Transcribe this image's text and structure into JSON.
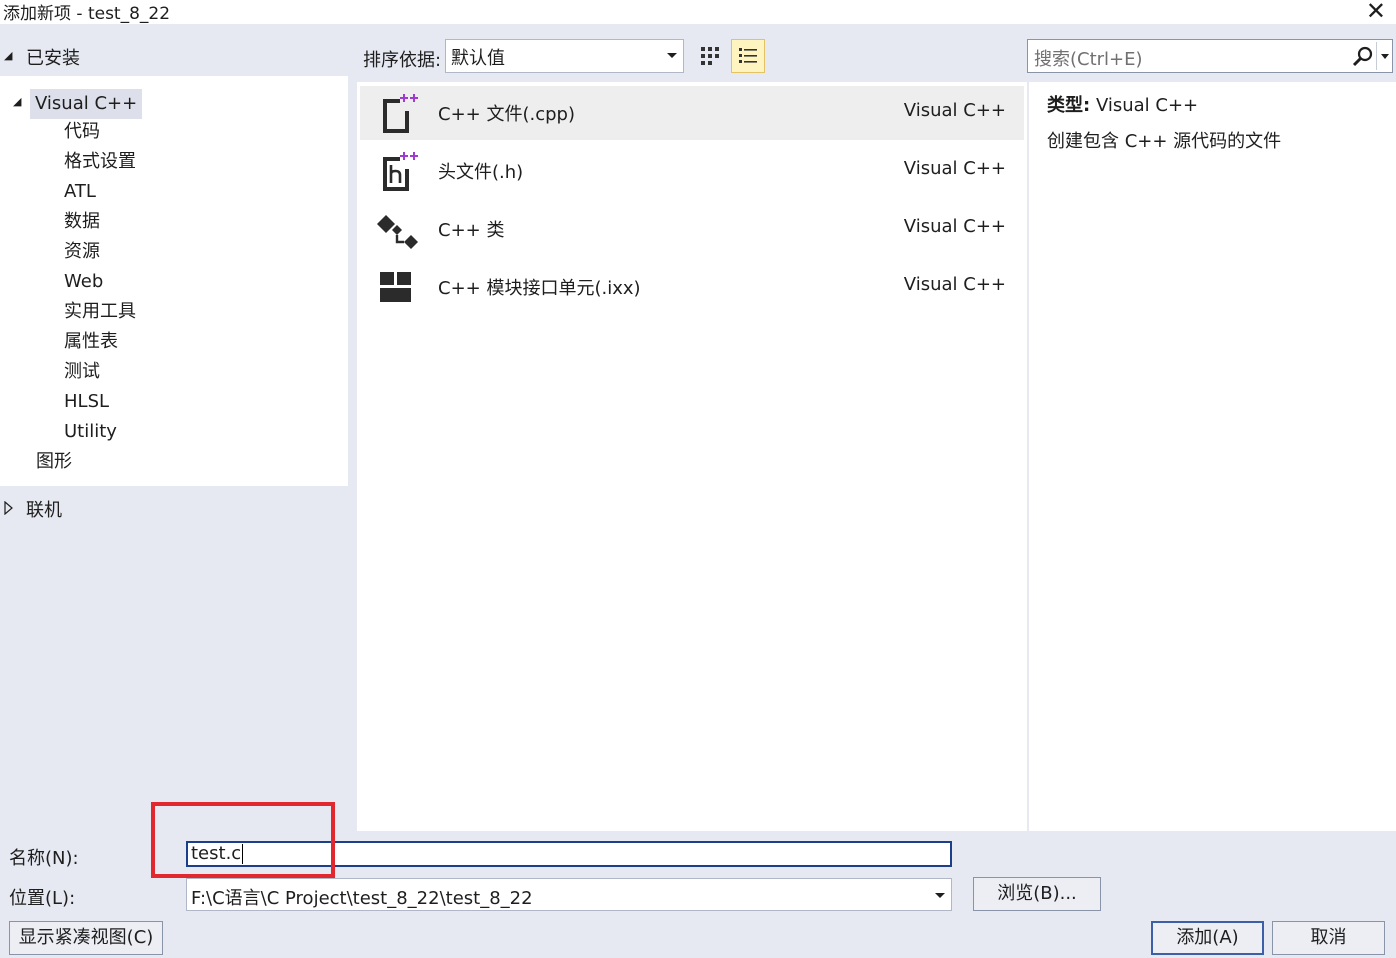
{
  "window": {
    "title": "添加新项 - test_8_22",
    "close_glyph": "✕"
  },
  "left_panel": {
    "installed_label": "已安装",
    "root_item": "Visual C++",
    "children": [
      "代码",
      "格式设置",
      "ATL",
      "数据",
      "资源",
      "Web",
      "实用工具",
      "属性表",
      "测试",
      "HLSL",
      "Utility"
    ],
    "sibling_item": "图形",
    "online_label": "联机"
  },
  "toolbar": {
    "sort_label": "排序依据:",
    "sort_value": "默认值",
    "search_placeholder": "搜索(Ctrl+E)"
  },
  "items": [
    {
      "name": "C++ 文件(.cpp)",
      "type": "Visual C++",
      "icon": "cpp-file-icon",
      "selected": true
    },
    {
      "name": "头文件(.h)",
      "type": "Visual C++",
      "icon": "header-file-icon",
      "selected": false
    },
    {
      "name": "C++ 类",
      "type": "Visual C++",
      "icon": "cpp-class-icon",
      "selected": false
    },
    {
      "name": "C++ 模块接口单元(.ixx)",
      "type": "Visual C++",
      "icon": "module-interface-icon",
      "selected": false
    }
  ],
  "details": {
    "type_label": "类型:",
    "type_value": "Visual C++",
    "description": "创建包含 C++ 源代码的文件"
  },
  "form": {
    "name_label": "名称(N):",
    "name_value": "test.c",
    "location_label": "位置(L):",
    "location_value": "F:\\C语言\\C Project\\test_8_22\\test_8_22",
    "browse_button": "浏览(B)...",
    "compact_view_button": "显示紧凑视图(C)",
    "add_button": "添加(A)",
    "cancel_button": "取消"
  },
  "colors": {
    "accent": "#3d5fa8",
    "highlight_annotation": "#e0282e",
    "selection_bg": "#eeeeef",
    "icon_plus": "#a13ad1"
  }
}
